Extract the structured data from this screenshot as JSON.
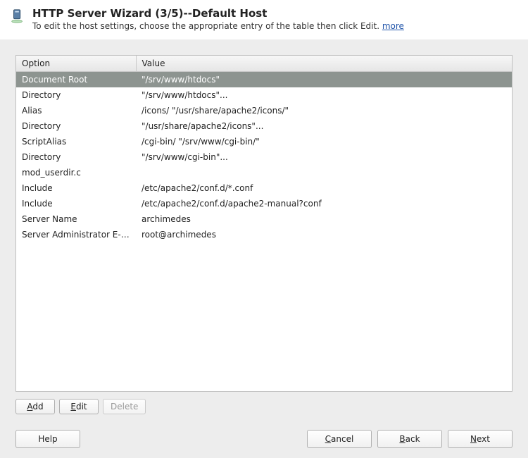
{
  "header": {
    "title": "HTTP Server Wizard (3/5)--Default Host",
    "subtitle_prefix": "To edit the host settings, choose the appropriate entry of the table then click Edit. ",
    "more_label": "more"
  },
  "table": {
    "columns": {
      "option": "Option",
      "value": "Value"
    },
    "rows": [
      {
        "option": "Document Root",
        "value": "\"/srv/www/htdocs\"",
        "selected": true
      },
      {
        "option": "Directory",
        "value": "\"/srv/www/htdocs\"..."
      },
      {
        "option": "Alias",
        "value": "/icons/ \"/usr/share/apache2/icons/\""
      },
      {
        "option": "Directory",
        "value": "\"/usr/share/apache2/icons\"..."
      },
      {
        "option": "ScriptAlias",
        "value": "/cgi-bin/ \"/srv/www/cgi-bin/\""
      },
      {
        "option": "Directory",
        "value": "\"/srv/www/cgi-bin\"..."
      },
      {
        "option": "mod_userdir.c",
        "value": ""
      },
      {
        "option": "Include",
        "value": "/etc/apache2/conf.d/*.conf"
      },
      {
        "option": "Include",
        "value": "/etc/apache2/conf.d/apache2-manual?conf"
      },
      {
        "option": "Server Name",
        "value": "archimedes"
      },
      {
        "option": "Server Administrator E-Mail",
        "value": "root@archimedes"
      }
    ]
  },
  "buttons": {
    "add": "Add",
    "edit": "Edit",
    "delete": "Delete",
    "help": "Help",
    "cancel": "Cancel",
    "back": "Back",
    "next": "Next"
  }
}
